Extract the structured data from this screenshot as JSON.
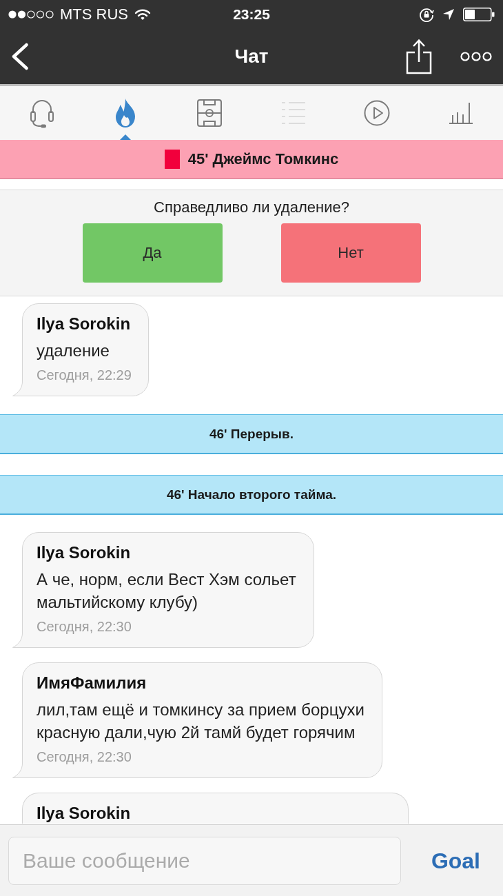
{
  "status_bar": {
    "carrier": "MTS RUS",
    "time": "23:25"
  },
  "nav_bar": {
    "title": "Чат"
  },
  "tabs": [
    {
      "kind": "headset",
      "selected": false,
      "disabled": false
    },
    {
      "kind": "fire",
      "selected": true,
      "disabled": false
    },
    {
      "kind": "pitch",
      "selected": false,
      "disabled": false
    },
    {
      "kind": "list",
      "selected": false,
      "disabled": true
    },
    {
      "kind": "play",
      "selected": false,
      "disabled": false
    },
    {
      "kind": "stats",
      "selected": false,
      "disabled": false
    }
  ],
  "feed": [
    {
      "kind": "red_card",
      "text": "45' Джеймс Томкинс"
    },
    {
      "kind": "poll",
      "question": "Справедливо ли удаление?",
      "options": [
        {
          "label": "Да",
          "color": "#72c765"
        },
        {
          "label": "Нет",
          "color": "#f57279"
        }
      ]
    },
    {
      "kind": "message",
      "author": "Ilya Sorokin",
      "text": "удаление",
      "time": "Сегодня, 22:29"
    },
    {
      "kind": "period",
      "text": "46' Перерыв."
    },
    {
      "kind": "period",
      "text": "46' Начало второго тайма."
    },
    {
      "kind": "message",
      "author": "Ilya Sorokin",
      "text": "А че, норм, если Вест Хэм сольет мальтийскому клубу)",
      "time": "Сегодня, 22:30"
    },
    {
      "kind": "message",
      "author": "ИмяФамилия",
      "text": "лил,там ещё и томкинсу за прием борцухи красную дали,чую 2й тамй будет горячим",
      "time": "Сегодня, 22:30"
    },
    {
      "kind": "message",
      "author": "Ilya Sorokin"
    }
  ],
  "composer": {
    "placeholder": "Ваше сообщение",
    "send_label": "Goal"
  }
}
